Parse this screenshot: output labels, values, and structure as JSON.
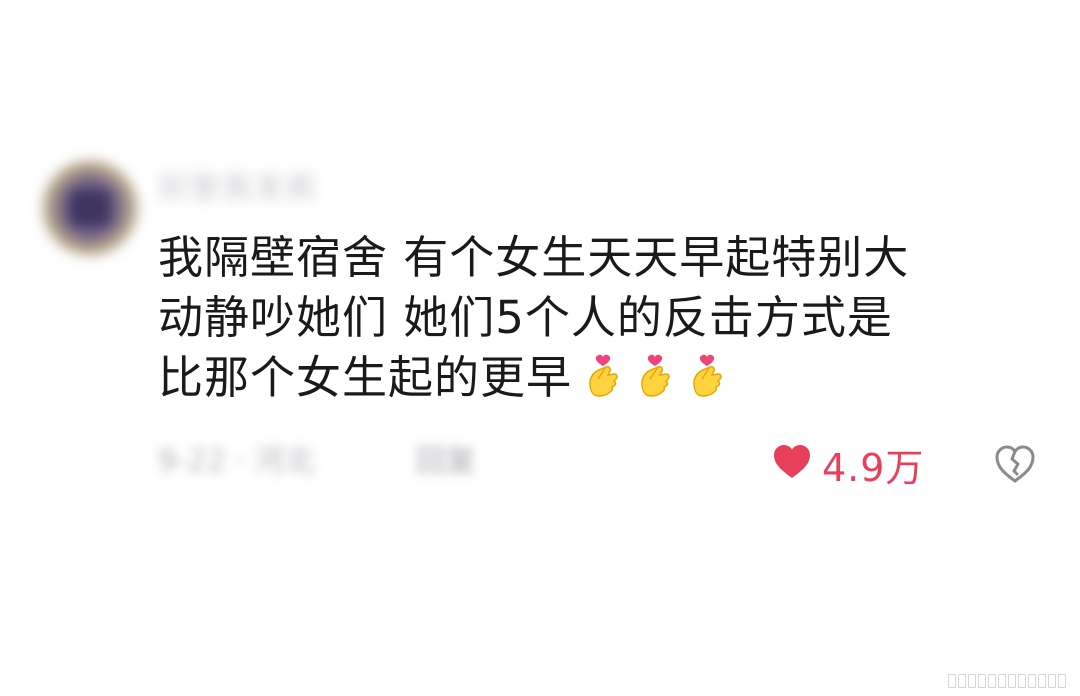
{
  "comment": {
    "username": "别管我发疯",
    "lines": [
      "我隔壁宿舍 有个女生天天早起特别大",
      "动静吵她们 她们5个人的反击方式是",
      "比那个女生起的更早"
    ],
    "emoji_icons": [
      "finger-heart-icon",
      "finger-heart-icon",
      "finger-heart-icon"
    ],
    "meta": "9-22 · 河北",
    "reply_label": "回复",
    "likes": "4.9万"
  },
  "colors": {
    "like": "#e8405a",
    "text": "#1a1a1a",
    "muted": "#b8b8be"
  }
}
